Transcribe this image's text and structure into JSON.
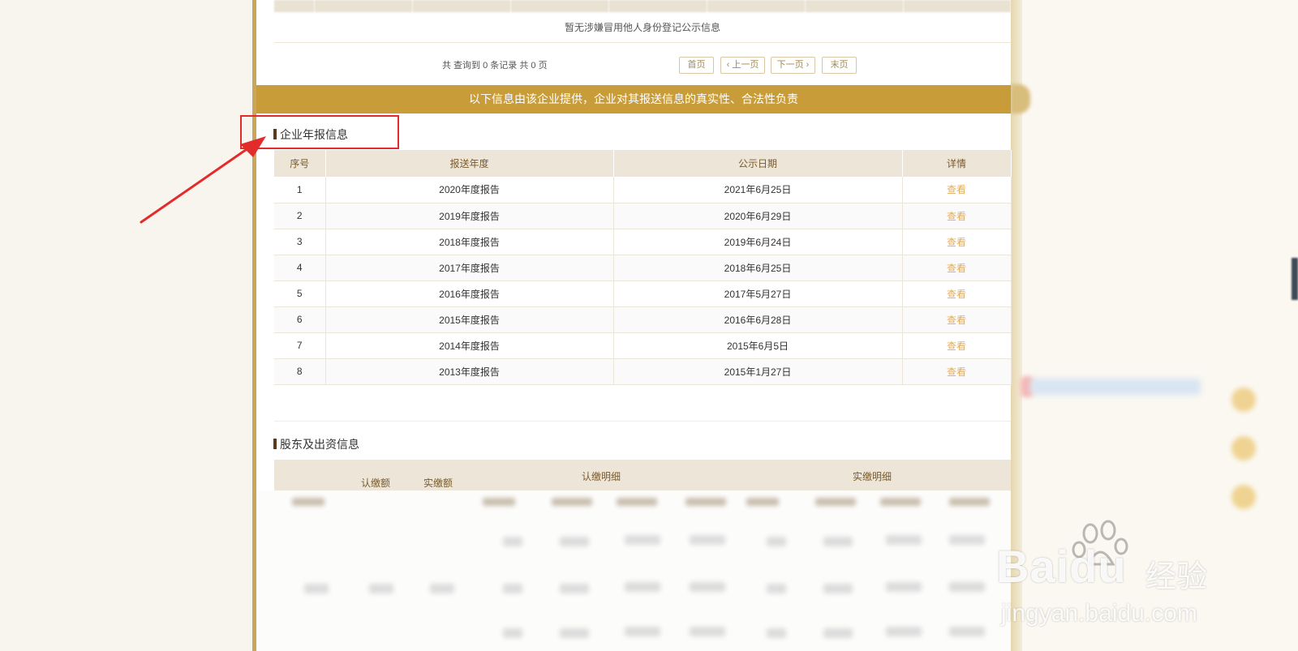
{
  "top_section": {
    "empty_text": "暂无涉嫌冒用他人身份登记公示信息"
  },
  "pager": {
    "info": "共 查询到 0 条记录 共 0 页",
    "first": "首页",
    "prev": "‹ 上一页",
    "next": "下一页 ›",
    "last": "末页"
  },
  "banner": "以下信息由该企业提供，企业对其报送信息的真实性、合法性负责",
  "annual_report": {
    "title": "企业年报信息",
    "headers": [
      "序号",
      "报送年度",
      "公示日期",
      "详情"
    ],
    "rows": [
      {
        "no": "1",
        "year": "2020年度报告",
        "date": "2021年6月25日",
        "action": "查看"
      },
      {
        "no": "2",
        "year": "2019年度报告",
        "date": "2020年6月29日",
        "action": "查看"
      },
      {
        "no": "3",
        "year": "2018年度报告",
        "date": "2019年6月24日",
        "action": "查看"
      },
      {
        "no": "4",
        "year": "2017年度报告",
        "date": "2018年6月25日",
        "action": "查看"
      },
      {
        "no": "5",
        "year": "2016年度报告",
        "date": "2017年5月27日",
        "action": "查看"
      },
      {
        "no": "6",
        "year": "2015年度报告",
        "date": "2016年6月28日",
        "action": "查看"
      },
      {
        "no": "7",
        "year": "2014年度报告",
        "date": "2015年6月5日",
        "action": "查看"
      },
      {
        "no": "8",
        "year": "2013年度报告",
        "date": "2015年1月27日",
        "action": "查看"
      }
    ]
  },
  "shareholders": {
    "title": "股东及出资信息",
    "headers": {
      "subscribed": "认缴额",
      "paid": "实缴额",
      "subscribed_detail": "认缴明细",
      "paid_detail": "实缴明细"
    }
  },
  "watermark": {
    "brand": "Bai",
    "brand_du": "du",
    "brand_cn": "经验",
    "url": "jingyan.baidu.com"
  },
  "colors": {
    "accent": "#c99c3a",
    "link": "#e2ac5c",
    "highlight": "#e32b2b"
  }
}
